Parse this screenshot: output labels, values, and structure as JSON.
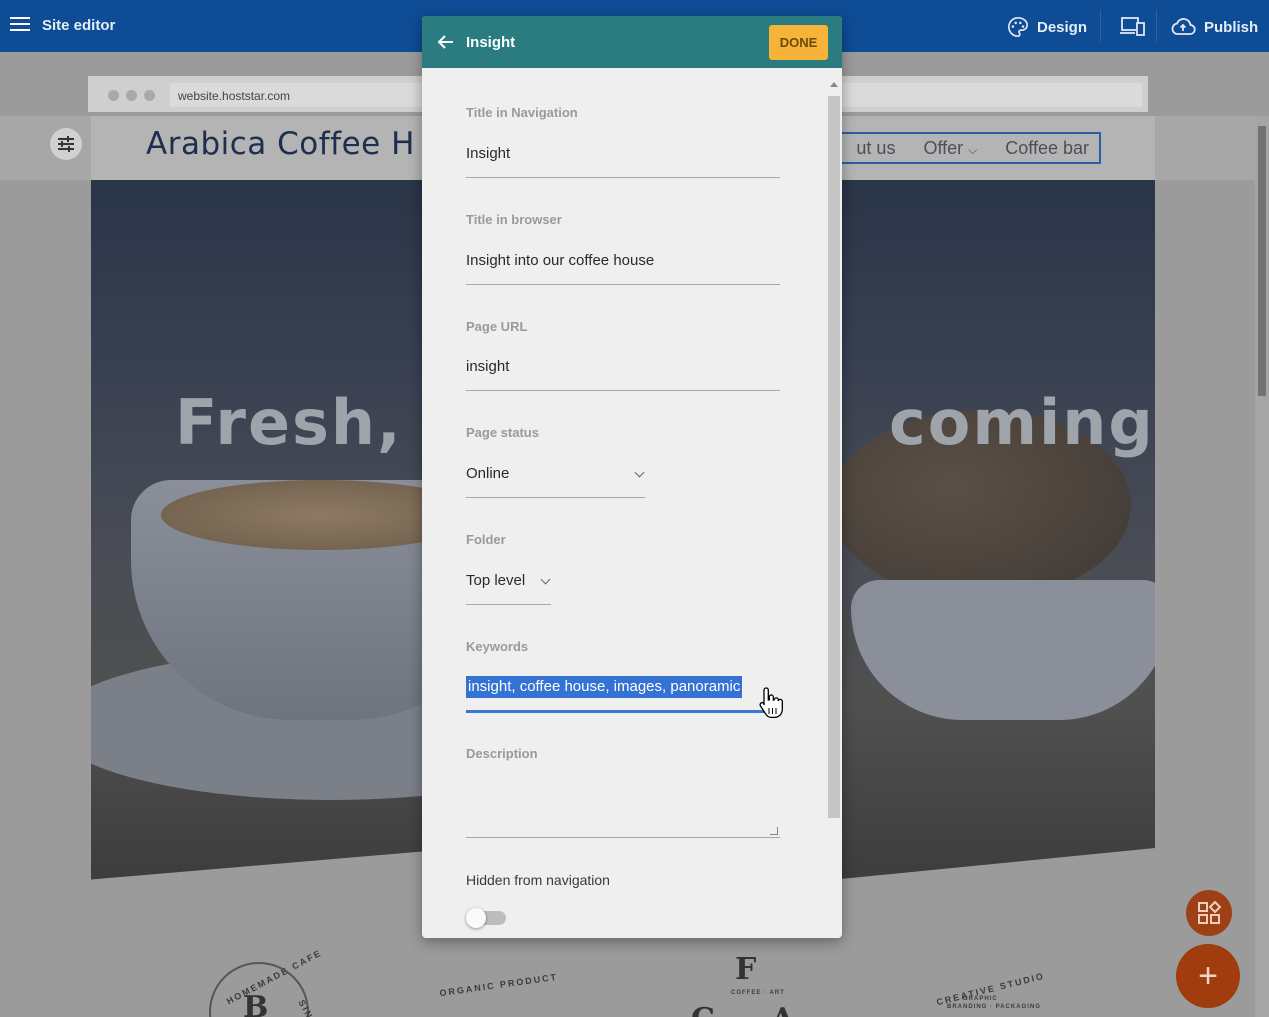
{
  "topbar": {
    "title": "Site editor",
    "design_label": "Design",
    "publish_label": "Publish"
  },
  "browser": {
    "url": "website.hoststar.com"
  },
  "site": {
    "logo": "Arabica Coffee H",
    "nav": [
      "ut us",
      "Offer",
      "Coffee bar"
    ],
    "hero_text_left": "Fresh, lo",
    "hero_text_right": "coming"
  },
  "badges": {
    "homemade": "HOMEMADE CAFE",
    "homemade_since": "SINCE",
    "homemade_letter": "B",
    "organic": "ORGANIC PRODUCT",
    "coffee_letter": "F",
    "coffee_small": "COFFEE · ART",
    "coffee_bottom_1": "C",
    "coffee_bottom_2": "A",
    "creative": "CREATIVE STUDIO",
    "creative_sub_1": "GRAPHIC",
    "creative_sub_2": "BRANDING · PACKAGING"
  },
  "dialog": {
    "title": "Insight",
    "done_label": "DONE",
    "fields": {
      "nav_title": {
        "label": "Title in Navigation",
        "value": "Insight"
      },
      "browser_title": {
        "label": "Title in browser",
        "value": "Insight into our coffee house"
      },
      "page_url": {
        "label": "Page URL",
        "value": "insight"
      },
      "page_status": {
        "label": "Page status",
        "value": "Online"
      },
      "folder": {
        "label": "Folder",
        "value": "Top level"
      },
      "keywords": {
        "label": "Keywords",
        "value": "insight, coffee house, images, panoramic"
      },
      "description": {
        "label": "Description",
        "value": ""
      }
    },
    "hidden_nav_label": "Hidden from navigation",
    "hidden_nav_on": false
  },
  "colors": {
    "topbar": "#0e4c96",
    "dialog_header": "#2a7c80",
    "done_button": "#f5b338",
    "selection": "#3472d3",
    "fab": "#a13c0f"
  },
  "icons": {
    "menu": "hamburger-icon",
    "design": "palette-icon",
    "devices": "devices-icon",
    "publish": "cloud-upload-icon",
    "back": "arrow-left-icon",
    "adjust": "sliders-icon",
    "widgets": "widgets-icon",
    "add": "plus-icon"
  }
}
